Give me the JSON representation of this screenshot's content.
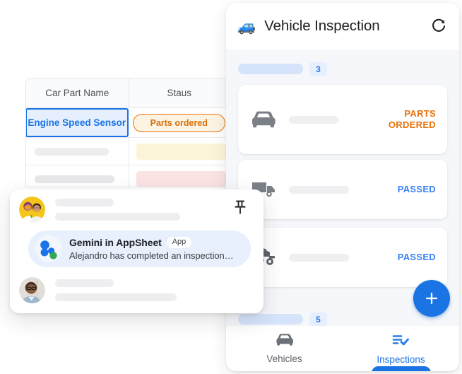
{
  "table": {
    "name": "car-parts-table",
    "columns": [
      "Car Part Name",
      "Staus"
    ],
    "rows": [
      {
        "part": "Engine Speed Sensor",
        "status": "Parts ordered",
        "selected": true
      },
      {
        "part": "",
        "status": "",
        "selected": false
      },
      {
        "part": "",
        "status": "",
        "selected": false
      }
    ],
    "selected_border_color": "#1a73e8",
    "chip_color": "#e8710a"
  },
  "phone": {
    "header": {
      "emoji": "🚙",
      "emoji_name": "blue-car-emoji",
      "title": "Vehicle Inspection",
      "refresh_icon": "refresh-icon"
    },
    "groups": [
      {
        "count": "3"
      },
      {
        "count": "5"
      }
    ],
    "inspections": [
      {
        "icon": "car-icon",
        "status": "PARTS\nORDERED",
        "status_line1": "PARTS",
        "status_line2": "ORDERED",
        "status_color": "#e8710a"
      },
      {
        "icon": "truck-icon",
        "status": "PASSED",
        "status_line1": "PASSED",
        "status_line2": "",
        "status_color": "#3b82f6"
      },
      {
        "icon": "tractor-icon",
        "status": "PASSED",
        "status_line1": "PASSED",
        "status_line2": "",
        "status_color": "#3b82f6"
      }
    ],
    "fab": {
      "label": "+",
      "name": "add-inspection-fab",
      "color": "#1b74e4"
    },
    "bottom_nav": [
      {
        "label": "Vehicles",
        "icon": "car-icon",
        "active": false
      },
      {
        "label": "Inspections",
        "icon": "checklist-icon",
        "active": true
      }
    ]
  },
  "chat": {
    "pin_icon": "pin-icon",
    "messages": [
      {
        "avatar": "avatar-two-people",
        "text": ""
      },
      {
        "avatar": "avatar-gemini",
        "title": "Gemini in AppSheet",
        "badge": "App",
        "subtitle": "Alejandro has completed an inspection…"
      },
      {
        "avatar": "avatar-man-glasses",
        "text": ""
      }
    ]
  }
}
